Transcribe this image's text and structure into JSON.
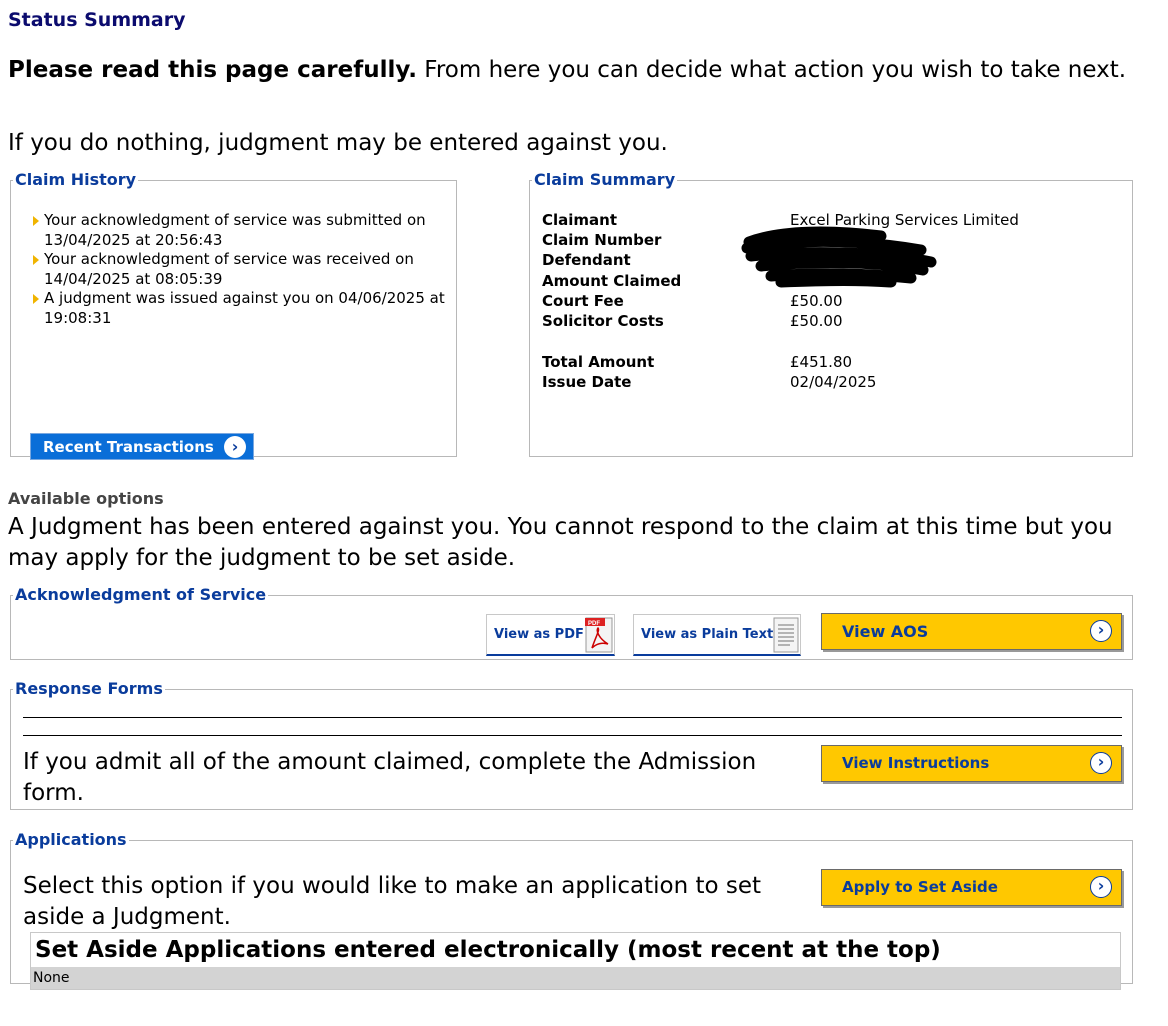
{
  "page": {
    "title": "Status Summary",
    "intro_bold": "Please read this page carefully.",
    "intro_rest": " From here you can decide what action you wish to take next.",
    "intro2": "If you do nothing, judgment may be entered against you."
  },
  "claim_history": {
    "legend": "Claim History",
    "items": [
      "Your acknowledgment of service was submitted on 13/04/2025 at 20:56:43",
      "Your acknowledgment of service was received on 14/04/2025 at 08:05:39",
      "A judgment was issued against you on 04/06/2025 at 19:08:31"
    ],
    "button_label": "Recent Transactions"
  },
  "claim_summary": {
    "legend": "Claim Summary",
    "rows": [
      {
        "label": "Claimant",
        "value": "Excel Parking Services Limited"
      },
      {
        "label": "Claim Number",
        "value": ""
      },
      {
        "label": "Defendant",
        "value": ""
      },
      {
        "label": "Amount Claimed",
        "value": ""
      },
      {
        "label": "Court Fee",
        "value": "£50.00"
      },
      {
        "label": "Solicitor Costs",
        "value": "£50.00"
      }
    ],
    "total_label": "Total Amount",
    "total_value": "£451.80",
    "issue_label": "Issue Date",
    "issue_value": "02/04/2025"
  },
  "options": {
    "heading": "Available options",
    "text": "A Judgment has been entered against you. You cannot respond to the claim at this time but you may apply for the judgment to be set aside."
  },
  "aos": {
    "legend": "Acknowledgment of Service",
    "pdf_label": "View as PDF",
    "pdf_icon_text": "PDF",
    "plain_label": "View as Plain Text",
    "view_label": "View AOS"
  },
  "response_forms": {
    "legend": "Response Forms",
    "text": "If you admit all of the amount claimed, complete the Admission form.",
    "button_label": "View Instructions"
  },
  "applications": {
    "legend": "Applications",
    "text": "Select this option if you would like to make an application to set aside a Judgment.",
    "button_label": "Apply to Set Aside",
    "table_heading": "Set Aside Applications entered electronically (most recent at the top)",
    "table_empty": "None"
  },
  "colors": {
    "accent_blue": "#0a3c9c",
    "button_yellow": "#ffc800",
    "button_blue": "#0a6ed8",
    "title_navy": "#0b0b6e"
  },
  "icons": {
    "bullet": "triangle-bullet-icon",
    "chevron": "chevron-right-circle-icon",
    "pdf": "pdf-document-icon",
    "text": "text-document-icon"
  }
}
